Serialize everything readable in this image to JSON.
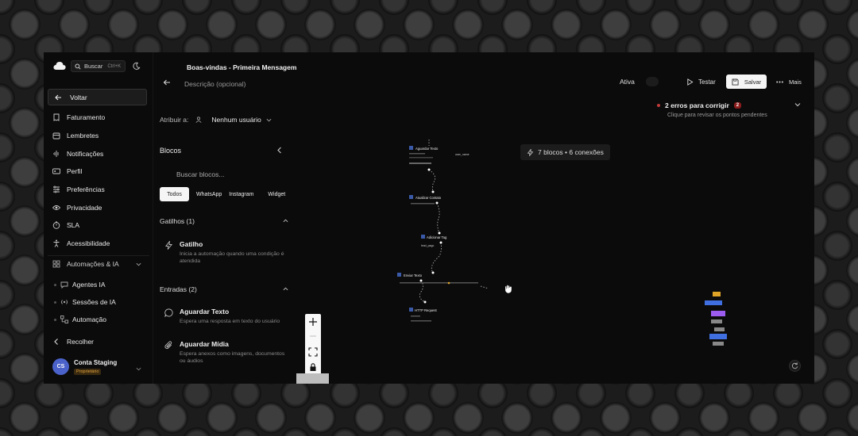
{
  "app": {
    "search_label": "Buscar",
    "search_shortcut": "Ctrl+K"
  },
  "sidebar": {
    "back_label": "Voltar",
    "items": [
      {
        "label": "Faturamento",
        "icon": "billing-icon"
      },
      {
        "label": "Lembretes",
        "icon": "calendar-icon"
      },
      {
        "label": "Notificações",
        "icon": "audio-wave-icon"
      },
      {
        "label": "Perfil",
        "icon": "id-card-icon"
      },
      {
        "label": "Preferências",
        "icon": "sliders-icon"
      },
      {
        "label": "Privacidade",
        "icon": "eye-icon"
      },
      {
        "label": "SLA",
        "icon": "timer-icon"
      },
      {
        "label": "Acessibilidade",
        "icon": "accessibility-icon"
      }
    ],
    "group_label": "Automações & IA",
    "sub_items": [
      {
        "label": "Agentes IA",
        "icon": "chat-icon"
      },
      {
        "label": "Sessões de IA",
        "icon": "broadcast-icon"
      },
      {
        "label": "Automação",
        "icon": "workflow-icon"
      }
    ],
    "collapse_label": "Recolher",
    "account": {
      "initials": "CS",
      "name": "Conta Staging",
      "role": "Proprietário"
    }
  },
  "header": {
    "title": "Boas-vindas - Primeira Mensagem",
    "description_placeholder": "Descrição (opcional)",
    "status_label": "Ativa",
    "test_label": "Testar",
    "save_label": "Salvar",
    "more_label": "Mais"
  },
  "assign": {
    "label": "Atribuir a:",
    "value": "Nenhum usuário"
  },
  "blocks_panel": {
    "title": "Blocos",
    "search_placeholder": "Buscar blocos...",
    "filters": [
      "Todos",
      "WhatsApp",
      "Instagram",
      "Widget"
    ],
    "groups": [
      {
        "label": "Gatilhos (1)",
        "items": [
          {
            "title": "Gatilho",
            "desc": "Inicia a automação quando uma condição é atendida",
            "icon": "lightning-icon"
          }
        ]
      },
      {
        "label": "Entradas (2)",
        "items": [
          {
            "title": "Aguardar Texto",
            "desc": "Espera uma resposta em texto do usuário",
            "icon": "message-circle-icon"
          },
          {
            "title": "Aguardar Mídia",
            "desc": "Espera anexos como imagens, documentos ou áudios",
            "icon": "paperclip-icon"
          }
        ]
      }
    ]
  },
  "canvas": {
    "summary": "7 blocos • 6 conexões",
    "nodes": [
      {
        "title": "Aguardar Texto",
        "meta": "user_name"
      },
      {
        "title": "Atualizar Contato"
      },
      {
        "title": "Adicionar Tag",
        "meta": "lead_pago"
      },
      {
        "title": "Enviar Texto"
      },
      {
        "title": "HTTP Request"
      }
    ],
    "minimap_colors": [
      "#e0a526",
      "#3f6fe0",
      "#9c5cf0",
      "#888888",
      "#3f6fe0"
    ]
  },
  "errors": {
    "title": "2 erros para corrigir",
    "count": "2",
    "subtitle": "Clique para revisar os pontos pendentes"
  }
}
